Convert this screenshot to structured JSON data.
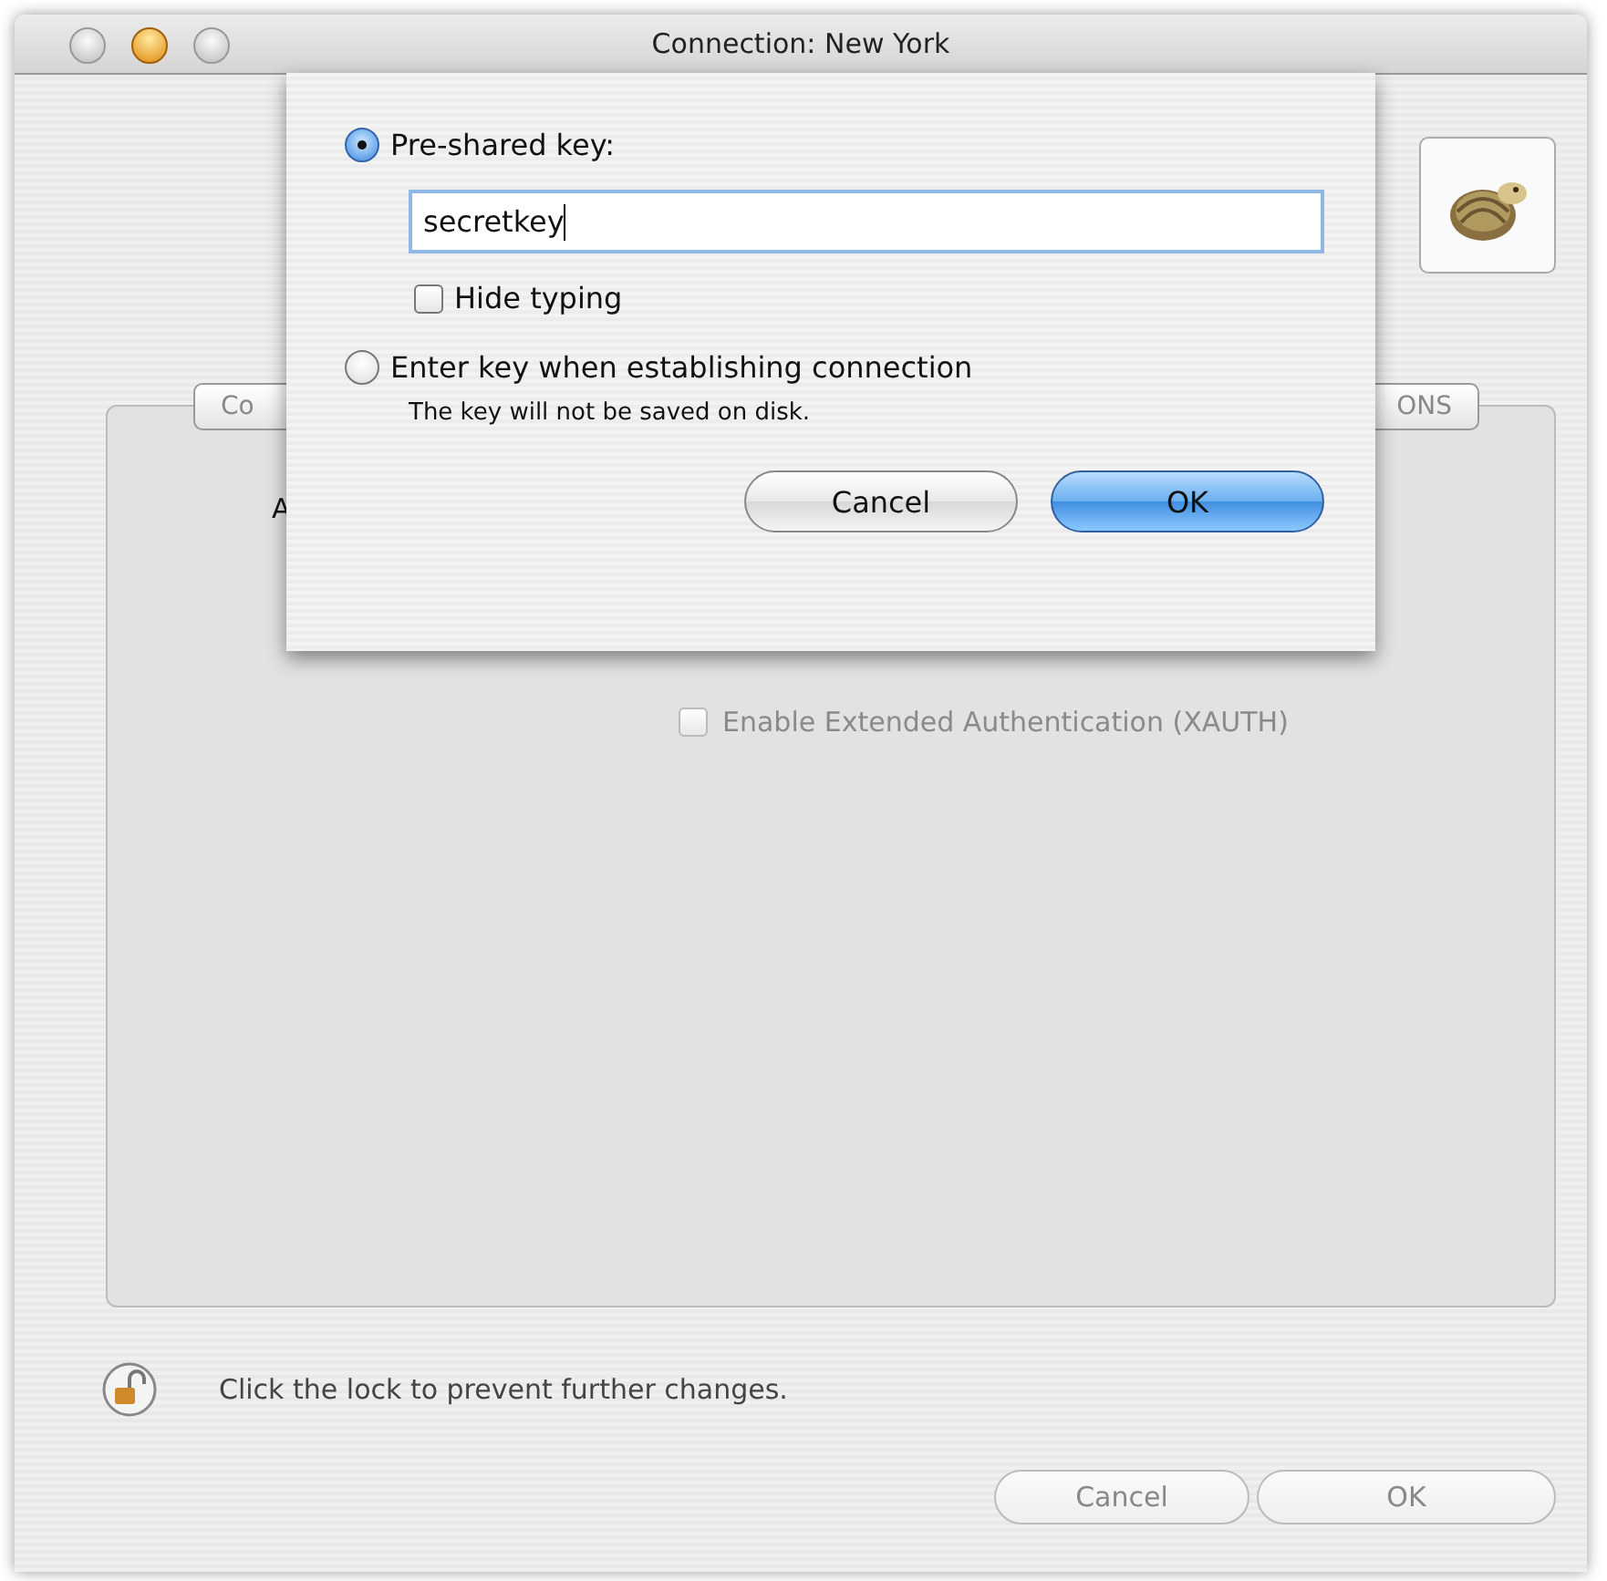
{
  "window": {
    "title": "Connection: New York"
  },
  "tabs": [
    {
      "label": "Co",
      "selected": false
    },
    {
      "label": "ONS",
      "selected": false
    }
  ],
  "panel": {
    "label_fragment": "A",
    "xauth": {
      "label": "Enable Extended Authentication (XAUTH)",
      "checked": false,
      "disabled": true
    }
  },
  "lock": {
    "text": "Click the lock to prevent further changes."
  },
  "buttons": [
    {
      "label": "Cancel",
      "disabled": true
    },
    {
      "label": "OK",
      "disabled": true
    }
  ],
  "sheet": {
    "options": [
      {
        "label": "Pre-shared key:",
        "selected": true
      },
      {
        "label": "Enter key when establishing connection",
        "selected": false,
        "note": "The key will not be saved on disk."
      }
    ],
    "key_field": {
      "value": "secretkey"
    },
    "hide_typing": {
      "label": "Hide typing",
      "checked": false
    },
    "buttons": [
      {
        "label": "Cancel",
        "default": false
      },
      {
        "label": "OK",
        "default": true
      }
    ]
  }
}
